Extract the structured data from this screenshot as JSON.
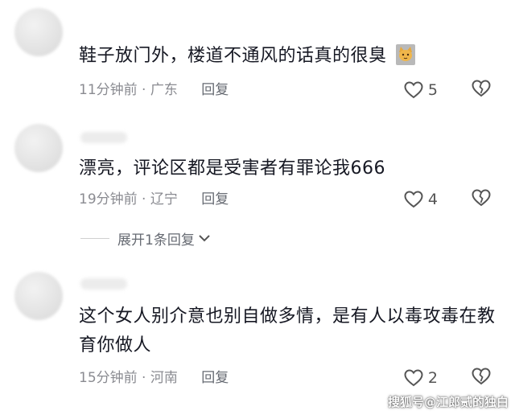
{
  "comments": [
    {
      "text": "鞋子放门外，楼道不通风的话真的很臭",
      "time_location": "11分钟前 · 广东",
      "reply_label": "回复",
      "like_count": "5"
    },
    {
      "text": "漂亮，评论区都是受害者有罪论我666",
      "time_location": "19分钟前 · 辽宁",
      "reply_label": "回复",
      "like_count": "4",
      "expand_label": "展开1条回复"
    },
    {
      "text": "这个女人别介意也别自做多情，是有人以毒攻毒在教育你做人",
      "time_location": "15分钟前 · 河南",
      "reply_label": "回复",
      "like_count": "2"
    }
  ],
  "watermark": "搜狐号@江郎贰的独白",
  "icons": {
    "like": "heart-outline-icon",
    "dislike": "broken-heart-icon",
    "expand": "chevron-down-icon",
    "emoji": "cat-emoji-icon"
  }
}
